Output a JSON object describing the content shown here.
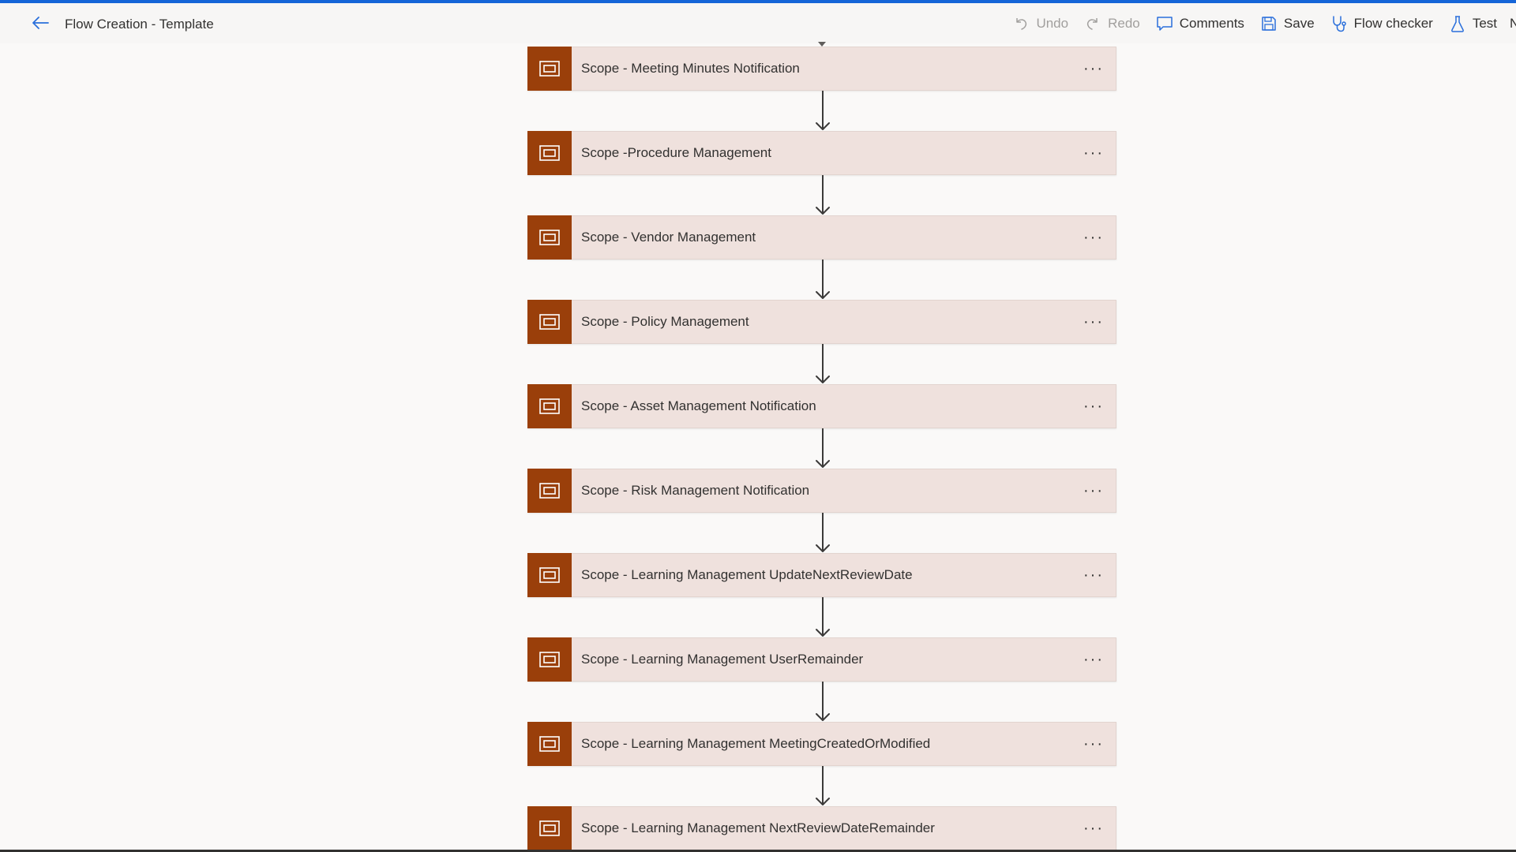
{
  "header": {
    "title": "Flow Creation - Template",
    "back_icon": "arrow-left-icon"
  },
  "toolbar": {
    "undo_label": "Undo",
    "redo_label": "Redo",
    "comments_label": "Comments",
    "save_label": "Save",
    "flow_checker_label": "Flow checker",
    "test_label": "Test",
    "truncated_label": "N"
  },
  "colors": {
    "accent": "#1565d8",
    "scope_icon_bg": "#9a3f0a",
    "scope_card_bg": "#efe1dd",
    "canvas_bg": "#faf9f8"
  },
  "steps": [
    {
      "label": "Scope - Meeting Minutes Notification",
      "icon": "scope-icon",
      "more": "···"
    },
    {
      "label": "Scope -Procedure Management",
      "icon": "scope-icon",
      "more": "···"
    },
    {
      "label": "Scope - Vendor Management",
      "icon": "scope-icon",
      "more": "···"
    },
    {
      "label": "Scope - Policy Management",
      "icon": "scope-icon",
      "more": "···"
    },
    {
      "label": "Scope - Asset Management Notification",
      "icon": "scope-icon",
      "more": "···"
    },
    {
      "label": "Scope - Risk Management Notification",
      "icon": "scope-icon",
      "more": "···"
    },
    {
      "label": "Scope - Learning Management UpdateNextReviewDate",
      "icon": "scope-icon",
      "more": "···"
    },
    {
      "label": "Scope - Learning Management UserRemainder",
      "icon": "scope-icon",
      "more": "···"
    },
    {
      "label": "Scope - Learning Management MeetingCreatedOrModified",
      "icon": "scope-icon",
      "more": "···"
    },
    {
      "label": "Scope - Learning Management NextReviewDateRemainder",
      "icon": "scope-icon",
      "more": "···"
    }
  ]
}
